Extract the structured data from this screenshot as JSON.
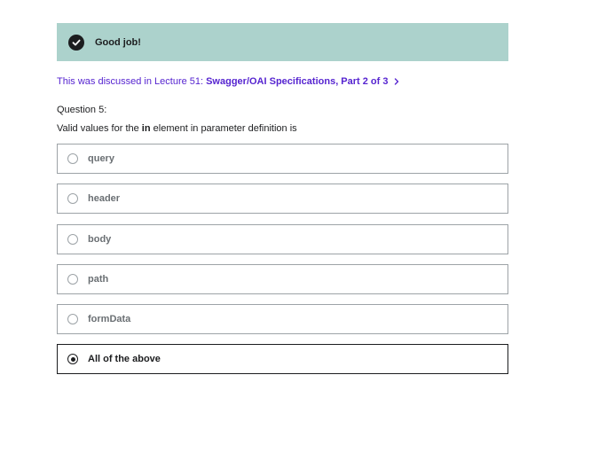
{
  "banner": {
    "icon": "check-circle-icon",
    "text": "Good job!",
    "color": "#acd2cc"
  },
  "lecture_ref": {
    "prefix": "This was discussed in Lecture 51:",
    "title": "Swagger/OAI Specifications, Part 2 of 3",
    "color": "#5624d0"
  },
  "question": {
    "number_label": "Question 5:",
    "prompt_before": "Valid values for the ",
    "prompt_bold": "in",
    "prompt_after": " element in parameter definition is"
  },
  "options": [
    {
      "label": "query",
      "selected": false
    },
    {
      "label": "header",
      "selected": false
    },
    {
      "label": "body",
      "selected": false
    },
    {
      "label": "path",
      "selected": false
    },
    {
      "label": "formData",
      "selected": false
    },
    {
      "label": "All of the above",
      "selected": true
    }
  ]
}
